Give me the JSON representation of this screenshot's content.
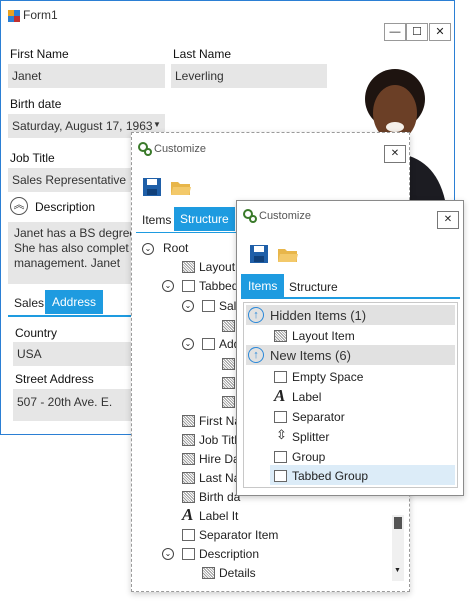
{
  "form1": {
    "title": "Form1",
    "min_glyph": "—",
    "max_glyph": "☐",
    "close_glyph": "✕",
    "first_name_label": "First Name",
    "first_name_value": "Janet",
    "last_name_label": "Last Name",
    "last_name_value": "Leverling",
    "birth_date_label": "Birth date",
    "birth_date_value": "Saturday, August 17, 1963",
    "job_title_label": "Job Title",
    "job_title_value": "Sales Representative",
    "description_label": "Description",
    "description_lines": [
      "Janet has a BS degree",
      "She has also complet",
      "management.  Janet"
    ],
    "tabs": [
      "Sales",
      "Address"
    ],
    "country_label": "Country",
    "country_value": "USA",
    "street_label": "Street Address",
    "street_value": "507 - 20th Ave. E."
  },
  "customize_back": {
    "title": "Customize",
    "close_glyph": "✕",
    "tabs": [
      "Items",
      "Structure"
    ],
    "tree": [
      {
        "label": "Root"
      },
      {
        "label": "Layout I"
      },
      {
        "label": "Tabbed"
      },
      {
        "label": "Sal"
      },
      {
        "label": "Add"
      },
      {
        "label": "First Nar"
      },
      {
        "label": "Job Title"
      },
      {
        "label": "Hire Dat"
      },
      {
        "label": "Last Nar"
      },
      {
        "label": "Birth da"
      },
      {
        "label": "Label It"
      },
      {
        "label": "Separator Item"
      },
      {
        "label": "Description"
      },
      {
        "label": "Details"
      }
    ]
  },
  "customize_front": {
    "title": "Customize",
    "close_glyph": "✕",
    "tabs": [
      "Items",
      "Structure"
    ],
    "hidden_header": "Hidden Items (1)",
    "hidden_items": [
      "Layout Item"
    ],
    "new_header": "New Items (6)",
    "new_items": [
      "Empty Space",
      "Label",
      "Separator",
      "Splitter",
      "Group",
      "Tabbed Group"
    ]
  },
  "colors": {
    "accent": "#2b88d8",
    "tab_active": "#1e9be0",
    "field_bg": "#e6e6e6",
    "header_bg": "#e1e1e1",
    "selected_row": "#dcecf8"
  }
}
